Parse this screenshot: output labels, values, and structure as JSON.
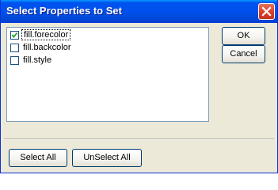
{
  "window": {
    "title": "Select Properties to Set"
  },
  "properties": {
    "items": [
      {
        "label": "fill.forecolor",
        "checked": true,
        "focused": true
      },
      {
        "label": "fill.backcolor",
        "checked": false,
        "focused": false
      },
      {
        "label": "fill.style",
        "checked": false,
        "focused": false
      }
    ]
  },
  "buttons": {
    "ok": "OK",
    "cancel": "Cancel",
    "select_all": "Select All",
    "unselect_all": "UnSelect All"
  },
  "icons": {
    "close": "close-icon",
    "check": "check-icon"
  },
  "colors": {
    "title_bar": "#0054e3",
    "close_button": "#d8402a",
    "dialog_bg": "#ece9d8"
  }
}
